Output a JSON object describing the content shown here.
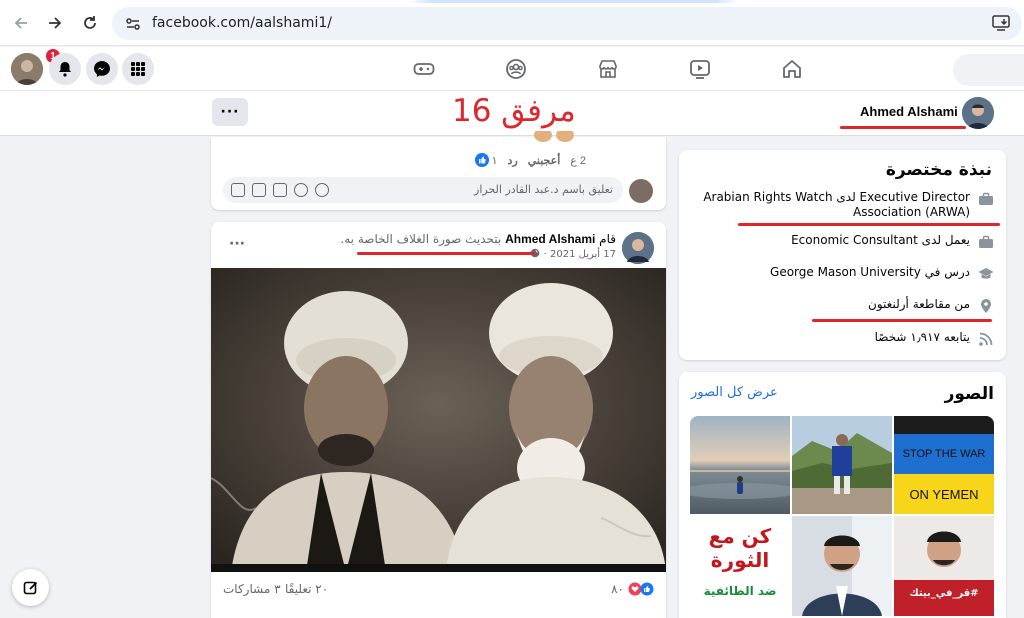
{
  "browser": {
    "url": "facebook.com/aalshami1/"
  },
  "header": {
    "notification_count": "1"
  },
  "profile_bar": {
    "more_label": "···",
    "name": "Ahmed Alshami",
    "attachment_label": "مرفق 16"
  },
  "post1": {
    "comment_count": "2 ع",
    "like_label": "أعجبني",
    "reply_label": "رد",
    "like_count": "١",
    "comment_placeholder": "تعليق باسم د.عبد القادر الحراز"
  },
  "post2": {
    "header_prefix": "قام",
    "author": "Ahmed Alshami",
    "action": "بتحديث صورة الغلاف الخاصة به.",
    "date": "17 أبريل 2021 ·",
    "more_label": "···",
    "reaction_count": "٨٠",
    "comments_label": "٢٠ تعليقًا",
    "shares_label": "٣ مشاركات"
  },
  "intro": {
    "title": "نبذة مختصرة",
    "items": [
      {
        "text": "Executive Director لدى Arabian Rights Watch Association (ARWA)",
        "icon": "briefcase-icon"
      },
      {
        "text": "يعمل لدى Economic Consultant",
        "icon": "briefcase-icon"
      },
      {
        "text": "درس في George Mason University",
        "icon": "graduation-cap-icon"
      },
      {
        "text": "من مقاطعة أرلنغتون",
        "icon": "location-pin-icon"
      },
      {
        "text": "يتابعه ١٫٩١٧ شخصًا",
        "icon": "rss-icon"
      }
    ]
  },
  "photos": {
    "title": "الصور",
    "see_all": "عرض كل الصور",
    "stop_war_line1": "STOP THE WAR",
    "stop_war_line2": "ON YEMEN",
    "calligraphy_top": "كن مع الثورة",
    "calligraphy_bottom": "ضد الطائفية",
    "tile_caption": "#قر_في_بيتك"
  },
  "colors": {
    "fb_blue": "#1877f2",
    "link_blue": "#216fdb",
    "annotation_red": "#e0262b",
    "page_bg": "#f0f2f5"
  }
}
